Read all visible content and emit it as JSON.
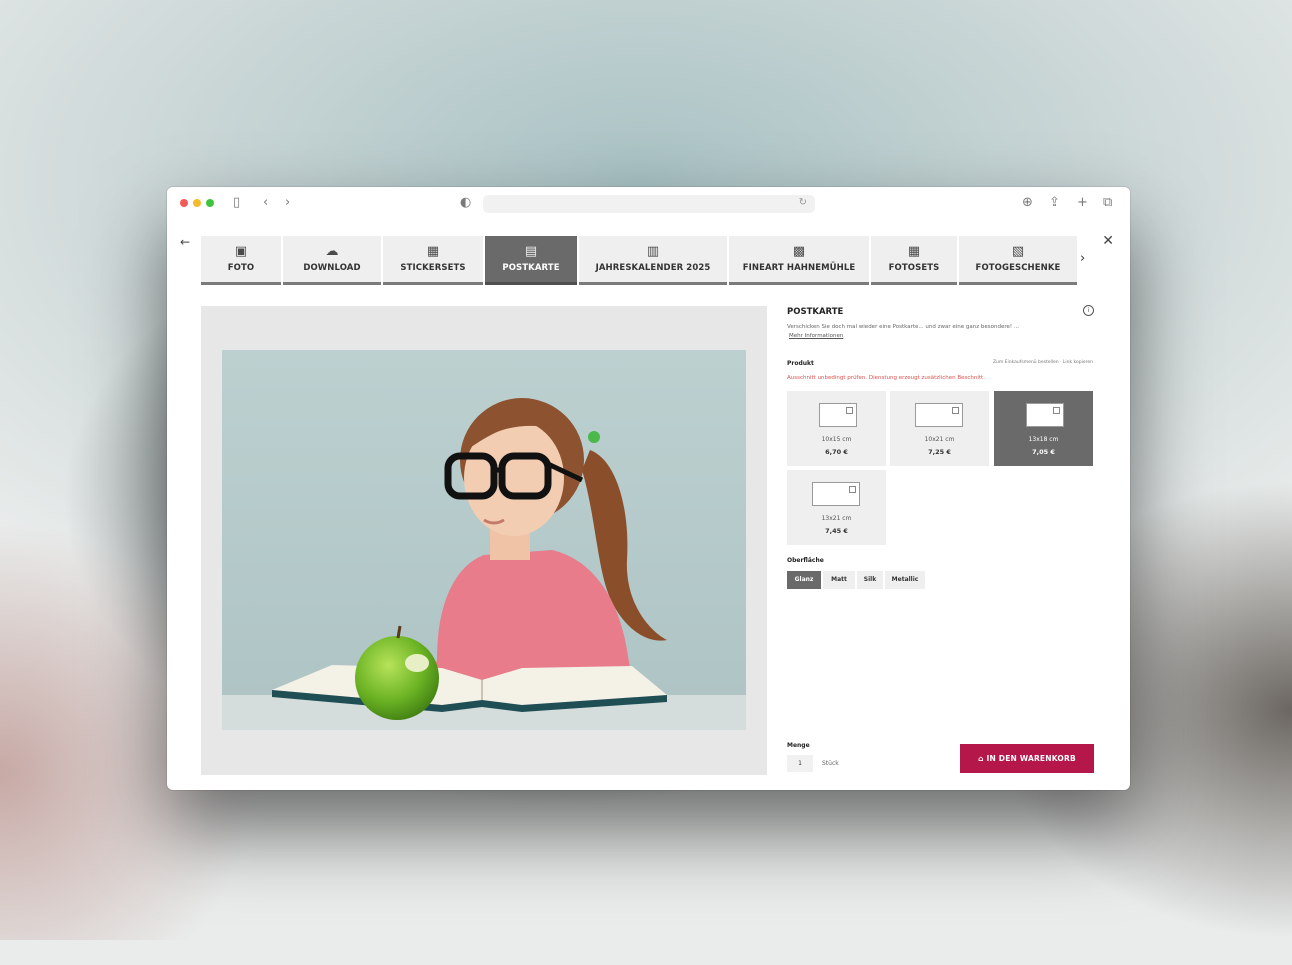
{
  "browser": {
    "address": "",
    "icons": [
      "sidebar-icon",
      "back-icon",
      "forward-icon",
      "privacy-icon",
      "reload-icon",
      "download-icon",
      "share-icon",
      "new-tab-icon",
      "tabs-overview-icon"
    ]
  },
  "tabs": [
    {
      "label": "FOTO",
      "icon": "photo-icon"
    },
    {
      "label": "DOWNLOAD",
      "icon": "cloud-download-icon"
    },
    {
      "label": "STICKERSETS",
      "icon": "sticker-icon"
    },
    {
      "label": "POSTKARTE",
      "icon": "postcard-icon",
      "active": true
    },
    {
      "label": "JAHRESKALENDER 2025",
      "icon": "calendar-icon"
    },
    {
      "label": "FINEART HAHNEMÜHLE",
      "icon": "fineart-icon"
    },
    {
      "label": "FOTOSETS",
      "icon": "photoset-icon"
    },
    {
      "label": "FOTOGESCHENKE",
      "icon": "gift-icon"
    }
  ],
  "panel": {
    "title": "POSTKARTE",
    "description": "Verschicken Sie doch mal wieder eine Postkarte... und zwar eine ganz besondere! ...",
    "more_link": "Mehr Informationen",
    "product_label": "Produkt",
    "links": "Zum Einkaufsmenü bestellen · Link kopieren",
    "warning": "Ausschnitt unbedingt prüfen. Dienstung erzeugt zusätzlichen Beschnitt.",
    "products": [
      {
        "size": "10x15 cm",
        "price": "6,70 €"
      },
      {
        "size": "10x21 cm",
        "price": "7,25 €"
      },
      {
        "size": "13x18 cm",
        "price": "7,05 €",
        "active": true
      },
      {
        "size": "13x21 cm",
        "price": "7,45 €"
      }
    ],
    "surface_label": "Oberfläche",
    "surfaces": [
      {
        "label": "Glanz",
        "active": true
      },
      {
        "label": "Matt"
      },
      {
        "label": "Silk"
      },
      {
        "label": "Metallic"
      }
    ],
    "quantity_label": "Menge",
    "quantity_value": "1",
    "quantity_unit": "Stück",
    "cart_button": "IN DEN WARENKORB"
  },
  "colors": {
    "accent": "#b5174a",
    "tab_active": "#6a6a6a"
  }
}
